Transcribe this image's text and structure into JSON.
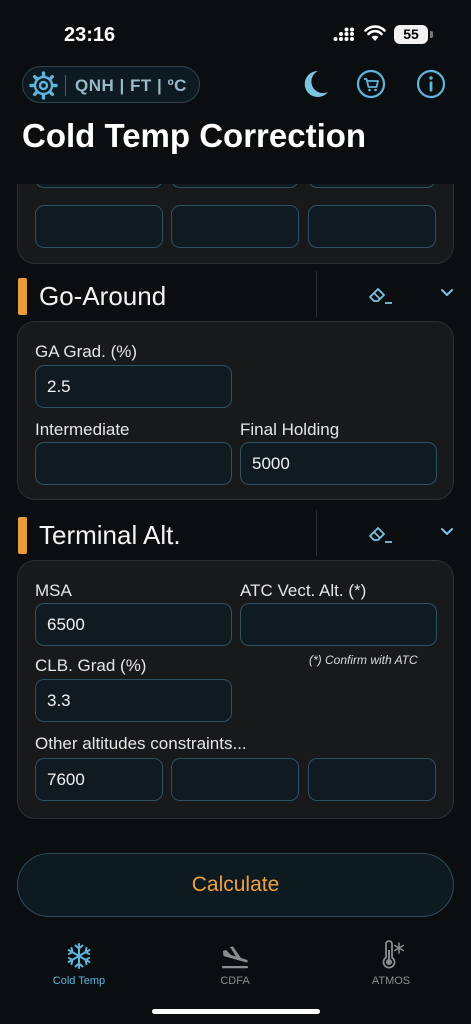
{
  "status_bar": {
    "time": "23:16",
    "battery": "55"
  },
  "header": {
    "units": "QNH | FT | ºC",
    "title": "Cold Temp Correction"
  },
  "go_around": {
    "title": "Go-Around",
    "ga_grad_label": "GA Grad. (%)",
    "ga_grad_value": "2.5",
    "intermediate_label": "Intermediate",
    "intermediate_value": "",
    "final_holding_label": "Final Holding",
    "final_holding_value": "5000"
  },
  "terminal_alt": {
    "title": "Terminal Alt.",
    "msa_label": "MSA",
    "msa_value": "6500",
    "atc_vect_label": "ATC Vect. Alt. (*)",
    "atc_vect_value": "",
    "confirm_note": "(*) Confirm with ATC",
    "clb_grad_label": "CLB. Grad (%)",
    "clb_grad_value": "3.3",
    "other_label": "Other altitudes constraints...",
    "other_values": [
      "7600",
      "",
      ""
    ]
  },
  "calculate_label": "Calculate",
  "tabs": [
    {
      "label": "Cold Temp",
      "icon": "snowflake-icon",
      "active": true
    },
    {
      "label": "CDFA",
      "icon": "airplane-landing-icon",
      "active": false
    },
    {
      "label": "ATMOS",
      "icon": "thermometer-snow-icon",
      "active": false
    }
  ],
  "colors": {
    "accent_orange": "#eb9b3a",
    "active_tab": "#5fb4dc",
    "field_border": "#2e5261",
    "background": "#0a0e10"
  }
}
